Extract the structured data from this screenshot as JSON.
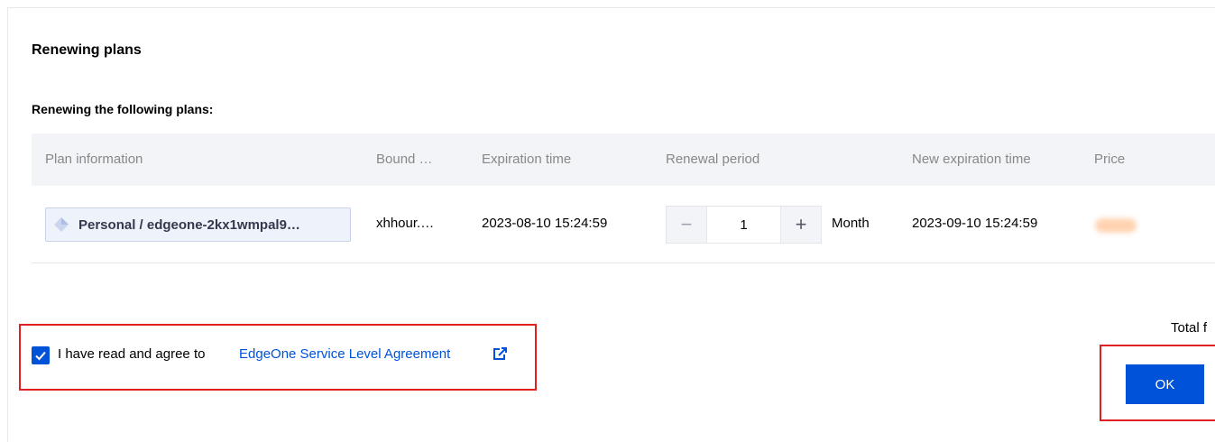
{
  "dialog": {
    "title": "Renewing plans",
    "subtitle": "Renewing the following plans:"
  },
  "table": {
    "headers": {
      "plan": "Plan information",
      "bound": "Bound …",
      "expiration": "Expiration time",
      "period": "Renewal period",
      "new_expiration": "New expiration time",
      "price": "Price"
    },
    "rows": [
      {
        "plan": "Personal / edgeone-2kx1wmpal9…",
        "bound": "xhhour.…",
        "expiration": "2023-08-10 15:24:59",
        "period_value": "1",
        "period_unit": "Month",
        "new_expiration": "2023-09-10 15:24:59",
        "price_icon": "blurred-price"
      }
    ]
  },
  "stepper": {
    "minus_icon": "minus-icon",
    "plus_icon": "plus-icon"
  },
  "agreement": {
    "checked": true,
    "text": "I have read and agree to",
    "link": "EdgeOne Service Level Agreement",
    "link_icon": "external-link-icon"
  },
  "footer": {
    "total_label": "Total f",
    "ok_label": "OK"
  },
  "colors": {
    "primary": "#0052d9",
    "highlight": "#e02020",
    "header_bg": "#f3f4f7",
    "price_blur": "#ffcfaa"
  }
}
